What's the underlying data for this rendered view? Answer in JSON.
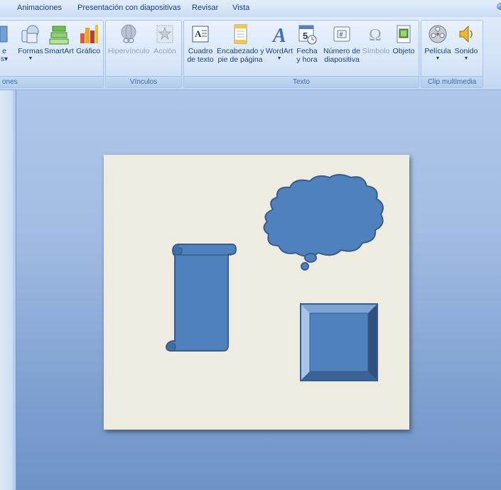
{
  "tabs": [
    "Animaciones",
    "Presentación con diapositivas",
    "Revisar",
    "Vista"
  ],
  "ribbon": {
    "groups": [
      {
        "label": "ones",
        "buttons": [
          {
            "line1": "e",
            "line2": "s",
            "has_caret": true,
            "icon": "partial-icon"
          },
          {
            "line1": "Formas",
            "line2": "",
            "has_caret": true,
            "icon": "shapes-icon"
          },
          {
            "line1": "SmartArt",
            "line2": "",
            "has_caret": false,
            "icon": "smartart-icon"
          },
          {
            "line1": "Gráfico",
            "line2": "",
            "has_caret": false,
            "icon": "chart-icon"
          }
        ]
      },
      {
        "label": "Vínculos",
        "buttons": [
          {
            "line1": "Hipervínculo",
            "line2": "",
            "has_caret": false,
            "icon": "hyperlink-globe-icon",
            "disabled": true
          },
          {
            "line1": "Acción",
            "line2": "",
            "has_caret": false,
            "icon": "action-star-icon",
            "disabled": true
          }
        ]
      },
      {
        "label": "Texto",
        "buttons": [
          {
            "line1": "Cuadro",
            "line2": "de texto",
            "has_caret": false,
            "icon": "textbox-icon"
          },
          {
            "line1": "Encabezado y",
            "line2": "pie de página",
            "has_caret": false,
            "icon": "header-footer-icon"
          },
          {
            "line1": "WordArt",
            "line2": "",
            "has_caret": true,
            "icon": "wordart-icon"
          },
          {
            "line1": "Fecha",
            "line2": "y hora",
            "has_caret": false,
            "icon": "date-time-icon"
          },
          {
            "line1": "Número de",
            "line2": "diapositiva",
            "has_caret": false,
            "icon": "slide-number-icon"
          },
          {
            "line1": "Símbolo",
            "line2": "",
            "has_caret": false,
            "icon": "omega-symbol-icon",
            "disabled": true
          },
          {
            "line1": "Objeto",
            "line2": "",
            "has_caret": false,
            "icon": "object-icon"
          }
        ]
      },
      {
        "label": "Clip multimedia",
        "buttons": [
          {
            "line1": "Película",
            "line2": "",
            "has_caret": true,
            "icon": "film-reel-icon"
          },
          {
            "line1": "Sonido",
            "line2": "",
            "has_caret": true,
            "icon": "speaker-icon"
          }
        ]
      }
    ]
  },
  "slide": {
    "background": "#eeece1",
    "shape_fill": "#4f81bd",
    "shape_stroke": "#385d8a",
    "shapes": [
      "vertical-scroll",
      "cloud-callout",
      "bevel-square"
    ]
  },
  "colors": {
    "ribbon_text": "#15428b",
    "workspace_top": "#aec6e8",
    "workspace_bottom": "#6f92c7"
  }
}
